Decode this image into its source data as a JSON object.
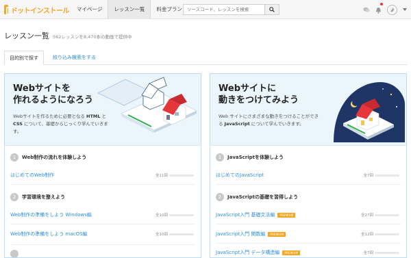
{
  "header": {
    "logo_text": "ドットインストール",
    "nav": [
      "マイページ",
      "レッスン一覧",
      "料金プラン"
    ],
    "search_placeholder": "ソースコード、レッスンを検索"
  },
  "page": {
    "title": "レッスン一覧",
    "subtitle": "562レッスンを8,470本の動画で提供中"
  },
  "tabs": [
    "目的別で探す",
    "絞り込み検索をする"
  ],
  "cards": [
    {
      "title_line1": "Webサイトを",
      "title_line2": "作れるようになろう",
      "desc_parts": [
        "Webサイトを作るために必要となる ",
        "HTML",
        " と ",
        "CSS",
        " について、基礎からじっくり学んでいきます。"
      ],
      "sections": [
        {
          "num": "1",
          "title": "Web制作の流れを体験しよう",
          "items": [
            {
              "name": "はじめてのWeb制作",
              "count": "全11回"
            }
          ]
        },
        {
          "num": "2",
          "title": "学習環境を整えよう",
          "items": [
            {
              "name": "Web制作の準備をしよう Windows編",
              "count": "全10回"
            },
            {
              "name": "Web制作の準備をしよう macOS編",
              "count": "全10回"
            }
          ]
        }
      ]
    },
    {
      "title_line1": "Webサイトに",
      "title_line2": "動きをつけてみよう",
      "desc_parts": [
        "Web サイトにさまざまな動きをつけることができる ",
        "JavaScript",
        " について学んでいきます。"
      ],
      "sections": [
        {
          "num": "1",
          "title": "JavaScriptを体験しよう",
          "items": [
            {
              "name": "はじめてのJavaScript",
              "count": "全7回"
            }
          ]
        },
        {
          "num": "2",
          "title": "JavaScriptの基礎を習得しよう",
          "items": [
            {
              "name": "JavaScript入門 基礎文法編",
              "count": "全27回",
              "badge": "PREMIUM"
            },
            {
              "name": "JavaScript入門 関数編",
              "count": "全12回",
              "badge": "PREMIUM"
            },
            {
              "name": "JavaScript入門 データ構造編",
              "count": "全7回",
              "badge": "PREMIUM"
            }
          ]
        }
      ]
    }
  ],
  "colors": {
    "accent": "#2a8fd7",
    "brand": "#f5a623",
    "hero_bg": "#eaf5fc",
    "house_roof": "#e5363b"
  },
  "icons": [
    "logo-icon",
    "search-icon",
    "chat-icon",
    "bell-icon",
    "avatar-icon",
    "caret-down-icon"
  ]
}
